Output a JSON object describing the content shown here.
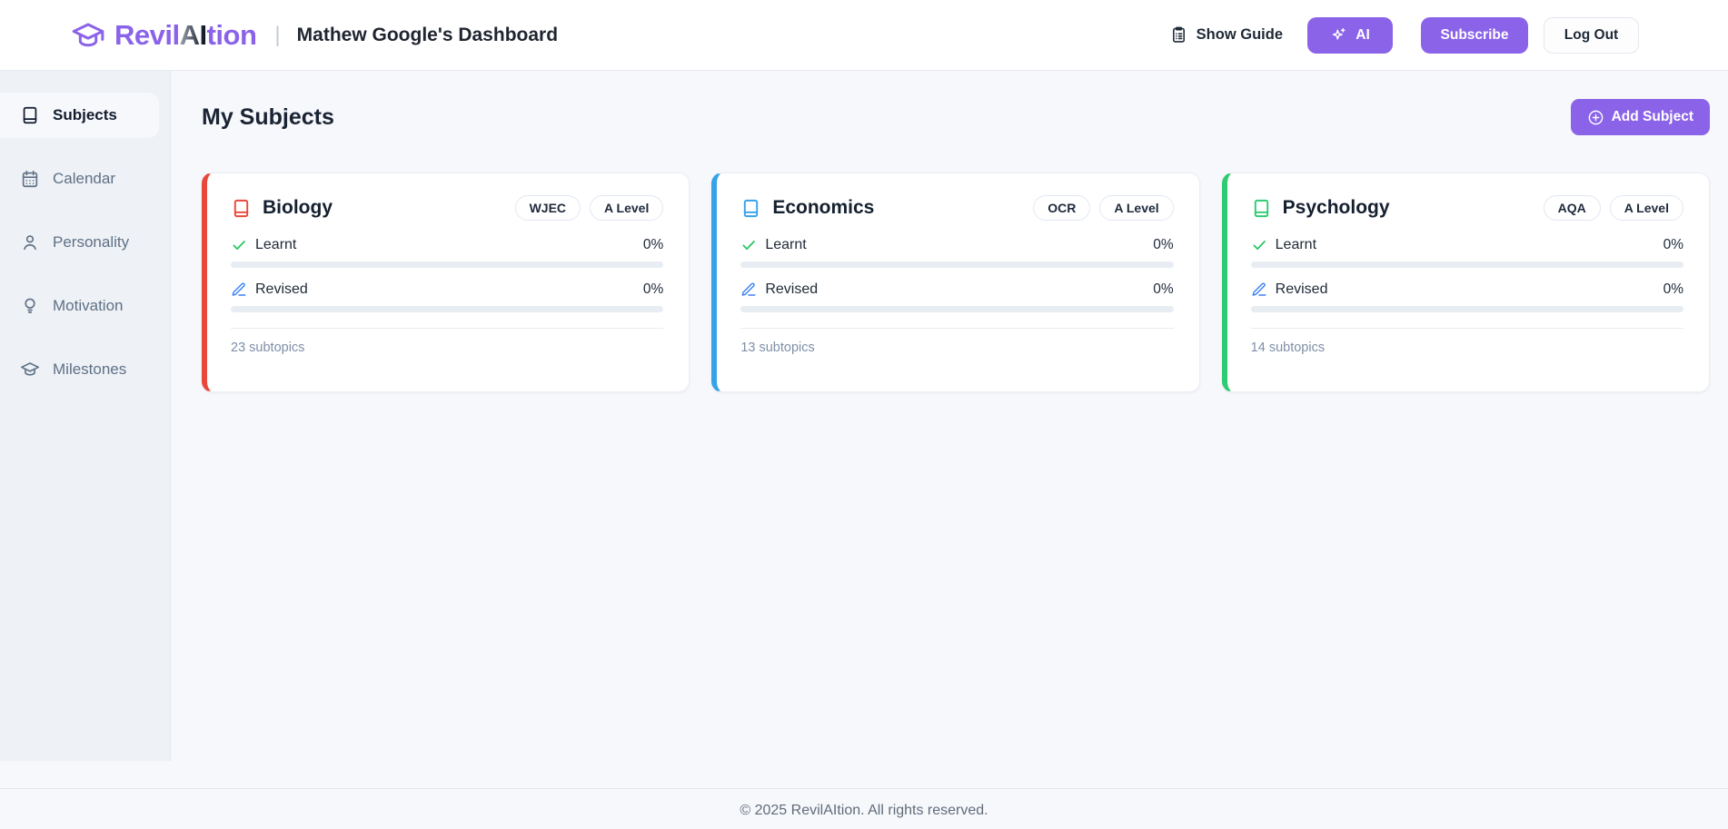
{
  "header": {
    "logo": {
      "brand_prefix": "Revil",
      "brand_ai": "AI",
      "brand_suffix": "tion"
    },
    "separator": "|",
    "dashboard_title": "Mathew Google's Dashboard",
    "show_guide_label": "Show Guide",
    "ai_label": "AI",
    "subscribe_label": "Subscribe",
    "logout_label": "Log Out"
  },
  "sidebar": {
    "items": [
      {
        "label": "Subjects",
        "icon": "book-icon",
        "active": true
      },
      {
        "label": "Calendar",
        "icon": "calendar-icon",
        "active": false
      },
      {
        "label": "Personality",
        "icon": "person-icon",
        "active": false
      },
      {
        "label": "Motivation",
        "icon": "lightbulb-icon",
        "active": false
      },
      {
        "label": "Milestones",
        "icon": "graduation-cap-icon",
        "active": false
      }
    ]
  },
  "main": {
    "title": "My Subjects",
    "add_subject_label": "Add Subject",
    "cards": [
      {
        "name": "Biology",
        "board": "WJEC",
        "level": "A Level",
        "accent": "#e8483c",
        "learnt_label": "Learnt",
        "learnt_value": "0%",
        "learnt_pct": 0,
        "revised_label": "Revised",
        "revised_value": "0%",
        "revised_pct": 0,
        "subtopics": "23 subtopics"
      },
      {
        "name": "Economics",
        "board": "OCR",
        "level": "A Level",
        "accent": "#36a3e8",
        "learnt_label": "Learnt",
        "learnt_value": "0%",
        "learnt_pct": 0,
        "revised_label": "Revised",
        "revised_value": "0%",
        "revised_pct": 0,
        "subtopics": "13 subtopics"
      },
      {
        "name": "Psychology",
        "board": "AQA",
        "level": "A Level",
        "accent": "#2fcb72",
        "learnt_label": "Learnt",
        "learnt_value": "0%",
        "learnt_pct": 0,
        "revised_label": "Revised",
        "revised_value": "0%",
        "revised_pct": 0,
        "subtopics": "14 subtopics"
      }
    ]
  },
  "footer": {
    "copyright": "© 2025 RevilAItion. All rights reserved."
  },
  "colors": {
    "accent_purple": "#8b63e8",
    "biology_red": "#e8483c",
    "economics_blue": "#36a3e8",
    "psychology_green": "#2fcb72",
    "learnt_check_green": "#22c55e",
    "revised_pen_blue": "#3b82f6",
    "sidebar_bg": "#eef1f6",
    "page_bg": "#f7f8fc"
  }
}
